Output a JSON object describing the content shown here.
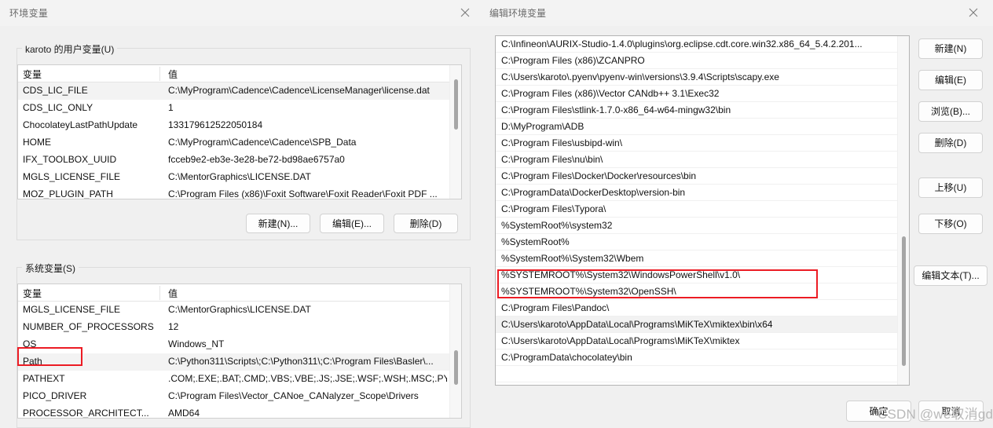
{
  "left_window": {
    "title": "环境变量",
    "close_icon": "close-icon",
    "user_group": {
      "label": "karoto 的用户变量(U)",
      "columns": [
        "变量",
        "值"
      ],
      "rows": [
        {
          "name": "CDS_LIC_FILE",
          "value": "C:\\MyProgram\\Cadence\\Cadence\\LicenseManager\\license.dat"
        },
        {
          "name": "CDS_LIC_ONLY",
          "value": "1"
        },
        {
          "name": "ChocolateyLastPathUpdate",
          "value": "133179612522050184"
        },
        {
          "name": "HOME",
          "value": "C:\\MyProgram\\Cadence\\Cadence\\SPB_Data"
        },
        {
          "name": "IFX_TOOLBOX_UUID",
          "value": "fcceb9e2-eb3e-3e28-be72-bd98ae6757a0"
        },
        {
          "name": "MGLS_LICENSE_FILE",
          "value": "C:\\MentorGraphics\\LICENSE.DAT"
        },
        {
          "name": "MOZ_PLUGIN_PATH",
          "value": "C:\\Program Files (x86)\\Foxit Software\\Foxit Reader\\Foxit PDF ..."
        }
      ],
      "buttons": [
        {
          "label": "新建(N)..."
        },
        {
          "label": "编辑(E)..."
        },
        {
          "label": "删除(D)"
        }
      ]
    },
    "system_group": {
      "label": "系统变量(S)",
      "columns": [
        "变量",
        "值"
      ],
      "rows": [
        {
          "name": "MGLS_LICENSE_FILE",
          "value": "C:\\MentorGraphics\\LICENSE.DAT"
        },
        {
          "name": "NUMBER_OF_PROCESSORS",
          "value": "12"
        },
        {
          "name": "OS",
          "value": "Windows_NT"
        },
        {
          "name": "Path",
          "value": "C:\\Python311\\Scripts\\;C:\\Python311\\;C:\\Program Files\\Basler\\..."
        },
        {
          "name": "PATHEXT",
          "value": ".COM;.EXE;.BAT;.CMD;.VBS;.VBE;.JS;.JSE;.WSF;.WSH;.MSC;.PY;.P..."
        },
        {
          "name": "PICO_DRIVER",
          "value": "C:\\Program Files\\Vector_CANoe_CANalyzer_Scope\\Drivers"
        },
        {
          "name": "PROCESSOR_ARCHITECT...",
          "value": "AMD64"
        }
      ]
    }
  },
  "right_window": {
    "title": "编辑环境变量",
    "close_icon": "close-icon",
    "path_entries": [
      "C:\\Infineon\\AURIX-Studio-1.4.0\\plugins\\org.eclipse.cdt.core.win32.x86_64_5.4.2.201...",
      "C:\\Program Files (x86)\\ZCANPRO",
      "C:\\Users\\karoto\\.pyenv\\pyenv-win\\versions\\3.9.4\\Scripts\\scapy.exe",
      "C:\\Program Files (x86)\\Vector CANdb++ 3.1\\Exec32",
      "C:\\Program Files\\stlink-1.7.0-x86_64-w64-mingw32\\bin",
      "D:\\MyProgram\\ADB",
      "C:\\Program Files\\usbipd-win\\",
      "C:\\Program Files\\nu\\bin\\",
      "C:\\Program Files\\Docker\\Docker\\resources\\bin",
      "C:\\ProgramData\\DockerDesktop\\version-bin",
      "C:\\Program Files\\Typora\\",
      "%SystemRoot%\\system32",
      "%SystemRoot%",
      "%SystemRoot%\\System32\\Wbem",
      "%SYSTEMROOT%\\System32\\WindowsPowerShell\\v1.0\\",
      "%SYSTEMROOT%\\System32\\OpenSSH\\",
      "C:\\Program Files\\Pandoc\\",
      "C:\\Users\\karoto\\AppData\\Local\\Programs\\MiKTeX\\miktex\\bin\\x64",
      "C:\\Users\\karoto\\AppData\\Local\\Programs\\MiKTeX\\miktex",
      "C:\\ProgramData\\chocolatey\\bin",
      ""
    ],
    "selected_index": 17,
    "side_buttons": [
      {
        "label": "新建(N)"
      },
      {
        "label": "编辑(E)"
      },
      {
        "label": "浏览(B)..."
      },
      {
        "label": "删除(D)"
      },
      {
        "label": "上移(U)"
      },
      {
        "label": "下移(O)"
      },
      {
        "label": "编辑文本(T)..."
      }
    ],
    "footer_buttons": [
      {
        "label": "确定"
      },
      {
        "label": "取消"
      }
    ],
    "watermark": "CSDN @we取消gdq"
  },
  "colors": {
    "annotation_red": "#ec1c24",
    "window_bg": "#f0f0f0",
    "list_bg": "#ffffff",
    "selection_bg": "#f2f2f2"
  }
}
